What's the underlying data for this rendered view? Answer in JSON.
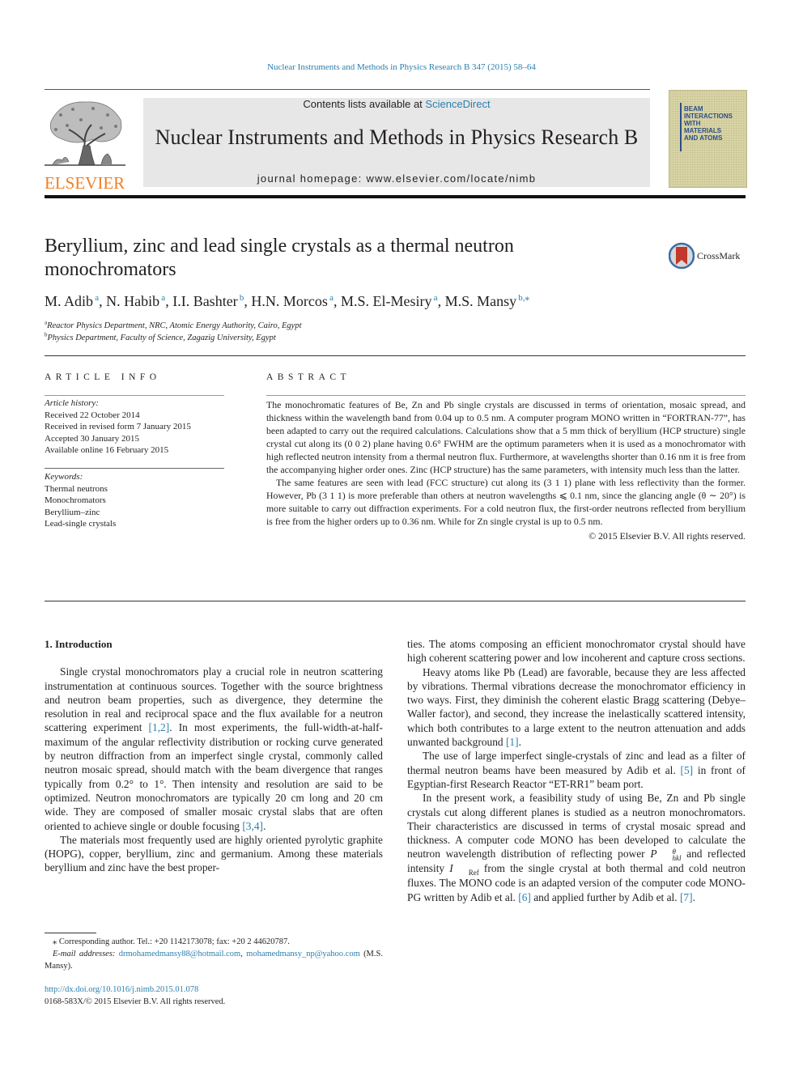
{
  "running_head": "Nuclear Instruments and Methods in Physics Research B 347 (2015) 58–64",
  "masthead": {
    "publisher_logo_text": "ELSEVIER",
    "contents_prefix": "Contents lists available at ",
    "contents_link": "ScienceDirect",
    "journal_name": "Nuclear Instruments and Methods in Physics Research B",
    "homepage_prefix": "journal homepage: ",
    "homepage_url": "www.elsevier.com/locate/nimb",
    "cover_title_lines": [
      "BEAM",
      "INTERACTIONS",
      "WITH",
      "MATERIALS",
      "AND ATOMS"
    ]
  },
  "article": {
    "title": "Beryllium, zinc and lead single crystals as a thermal neutron monochromators",
    "crossmark_label": "CrossMark",
    "authors": [
      {
        "name": "M. Adib",
        "aff": "a"
      },
      {
        "name": "N. Habib",
        "aff": "a"
      },
      {
        "name": "I.I. Bashter",
        "aff": "b"
      },
      {
        "name": "H.N. Morcos",
        "aff": "a"
      },
      {
        "name": "M.S. El-Mesiry",
        "aff": "a"
      },
      {
        "name": "M.S. Mansy",
        "aff": "b,⁎"
      }
    ],
    "affiliations": [
      {
        "label": "a",
        "text": "Reactor Physics Department, NRC, Atomic Energy Authority, Cairo, Egypt"
      },
      {
        "label": "b",
        "text": "Physics Department, Faculty of Science, Zagazig University, Egypt"
      }
    ]
  },
  "article_info": {
    "heading": "ARTICLE INFO",
    "history_label": "Article history:",
    "history": [
      "Received 22 October 2014",
      "Received in revised form 7 January 2015",
      "Accepted 30 January 2015",
      "Available online 16 February 2015"
    ],
    "keywords_label": "Keywords:",
    "keywords": [
      "Thermal neutrons",
      "Monochromators",
      "Beryllium–zinc",
      "Lead-single crystals"
    ]
  },
  "abstract": {
    "heading": "ABSTRACT",
    "paragraphs": [
      "The monochromatic features of Be, Zn and Pb single crystals are discussed in terms of orientation, mosaic spread, and thickness within the wavelength band from 0.04 up to 0.5 nm. A computer program MONO written in “FORTRAN-77”, has been adapted to carry out the required calculations. Calculations show that a 5 mm thick of beryllium (HCP structure) single crystal cut along its (0 0 2) plane having 0.6° FWHM are the optimum parameters when it is used as a monochromator with high reflected neutron intensity from a thermal neutron flux. Furthermore, at wavelengths shorter than 0.16 nm it is free from the accompanying higher order ones. Zinc (HCP structure) has the same parameters, with intensity much less than the latter.",
      "The same features are seen with lead (FCC structure) cut along its (3 1 1) plane with less reflectivity than the former. However, Pb (3 1 1) is more preferable than others at neutron wavelengths ⩽ 0.1 nm, since the glancing angle (θ ∼ 20°) is more suitable to carry out diffraction experiments. For a cold neutron flux, the first-order neutrons reflected from beryllium is free from the higher orders up to 0.36 nm. While for Zn single crystal is up to 0.5 nm."
    ],
    "copyright": "© 2015 Elsevier B.V. All rights reserved."
  },
  "body": {
    "section_heading": "1. Introduction",
    "left_paragraphs": [
      {
        "parts": [
          {
            "t": "Single crystal monochromators play a crucial role in neutron scattering instrumentation at continuous sources. Together with the source brightness and neutron beam properties, such as divergence, they determine the resolution in real and reciprocal space and the flux available for a neutron scattering experiment "
          },
          {
            "ref": "[1,2]"
          },
          {
            "t": ". In most experiments, the full-width-at-half-maximum of the angular reflectivity distribution or rocking curve generated by neutron diffraction from an imperfect single crystal, commonly called neutron mosaic spread, should match with the beam divergence that ranges typically from 0.2° to 1°. Then intensity and resolution are said to be optimized. Neutron monochromators are typically 20 cm long and 20 cm wide. They are composed of smaller mosaic crystal slabs that are often oriented to achieve single or double focusing "
          },
          {
            "ref": "[3,4]"
          },
          {
            "t": "."
          }
        ]
      },
      {
        "parts": [
          {
            "t": "The materials most frequently used are highly oriented pyrolytic graphite (HOPG), copper, beryllium, zinc and germanium. Among these materials beryllium and zinc have the best proper-"
          }
        ]
      }
    ],
    "right_paragraphs": [
      {
        "noindent": true,
        "parts": [
          {
            "t": "ties. The atoms composing an efficient monochromator crystal should have high coherent scattering power and low incoherent and capture cross sections."
          }
        ]
      },
      {
        "parts": [
          {
            "t": "Heavy atoms like Pb (Lead) are favorable, because they are less affected by vibrations. Thermal vibrations decrease the monochromator efficiency in two ways. First, they diminish the coherent elastic Bragg scattering (Debye–Waller factor), and second, they increase the inelastically scattered intensity, which both contributes to a large extent to the neutron attenuation and adds unwanted background "
          },
          {
            "ref": "[1]"
          },
          {
            "t": "."
          }
        ]
      },
      {
        "parts": [
          {
            "t": "The use of large imperfect single-crystals of zinc and lead as a filter of thermal neutron beams have been measured by Adib et al. "
          },
          {
            "ref": "[5]"
          },
          {
            "t": " in front of Egyptian-first Research Reactor “ET-RR1” beam port."
          }
        ]
      },
      {
        "parts": [
          {
            "t": "In the present work, a feasibility study of using Be, Zn and Pb single crystals cut along different planes is studied as a neutron monochromators. Their characteristics are discussed in terms of crystal mosaic spread and thickness. A computer code MONO has been developed to calculate the neutron wavelength distribution of reflecting power "
          },
          {
            "math": "P",
            "sup": "θ",
            "sub": "hkl"
          },
          {
            "t": " and reflected intensity "
          },
          {
            "math": "I",
            "sub": "Ref"
          },
          {
            "t": " from the single crystal at both thermal and cold neutron fluxes. The MONO code is an adapted version of the computer code MONO-PG written by Adib et al. "
          },
          {
            "ref": "[6]"
          },
          {
            "t": " and applied further by Adib et al. "
          },
          {
            "ref": "[7]"
          },
          {
            "t": "."
          }
        ]
      }
    ]
  },
  "footnotes": {
    "corresponding": "⁎ Corresponding author. Tel.: +20 1142173078; fax: +20 2 44620787.",
    "email_label": "E-mail addresses:",
    "emails": [
      "drmohamedmansy88@hotmail.com",
      "mohamedmansy_np@yahoo.com"
    ],
    "email_owner": "(M.S. Mansy).",
    "doi": "http://dx.doi.org/10.1016/j.nimb.2015.01.078",
    "issn_line": "0168-583X/© 2015 Elsevier B.V. All rights reserved."
  },
  "colors": {
    "link": "#2a7fad",
    "elsevier_orange": "#f07f22",
    "banner_gray": "#e7e7e7",
    "text": "#231f20"
  }
}
